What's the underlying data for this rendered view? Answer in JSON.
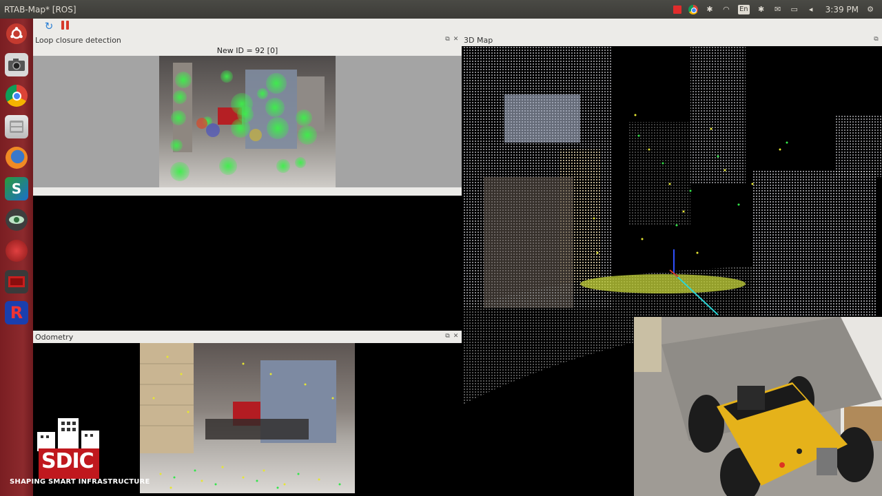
{
  "window": {
    "title": "RTAB-Map* [ROS]"
  },
  "tray": {
    "language": "En",
    "clock": "3:39 PM"
  },
  "toolbar": {
    "refresh_icon": "refresh-icon",
    "pause_icon": "pause-icon"
  },
  "loop_panel": {
    "title": "Loop closure detection",
    "new_id_label": "New ID = 92 [0]"
  },
  "odometry_panel": {
    "title": "Odometry"
  },
  "map_panel": {
    "title": "3D Map"
  },
  "watermark": {
    "brand": "SDIC",
    "tagline": "SHAPING SMART INFRASTRUCTURE"
  },
  "colors": {
    "feature_green": "#33e64a",
    "feature_yellow": "#e6e633",
    "launcher_red": "#8c2a2d",
    "pause_red": "#d63a2a",
    "refresh_blue": "#2a7fd4"
  }
}
